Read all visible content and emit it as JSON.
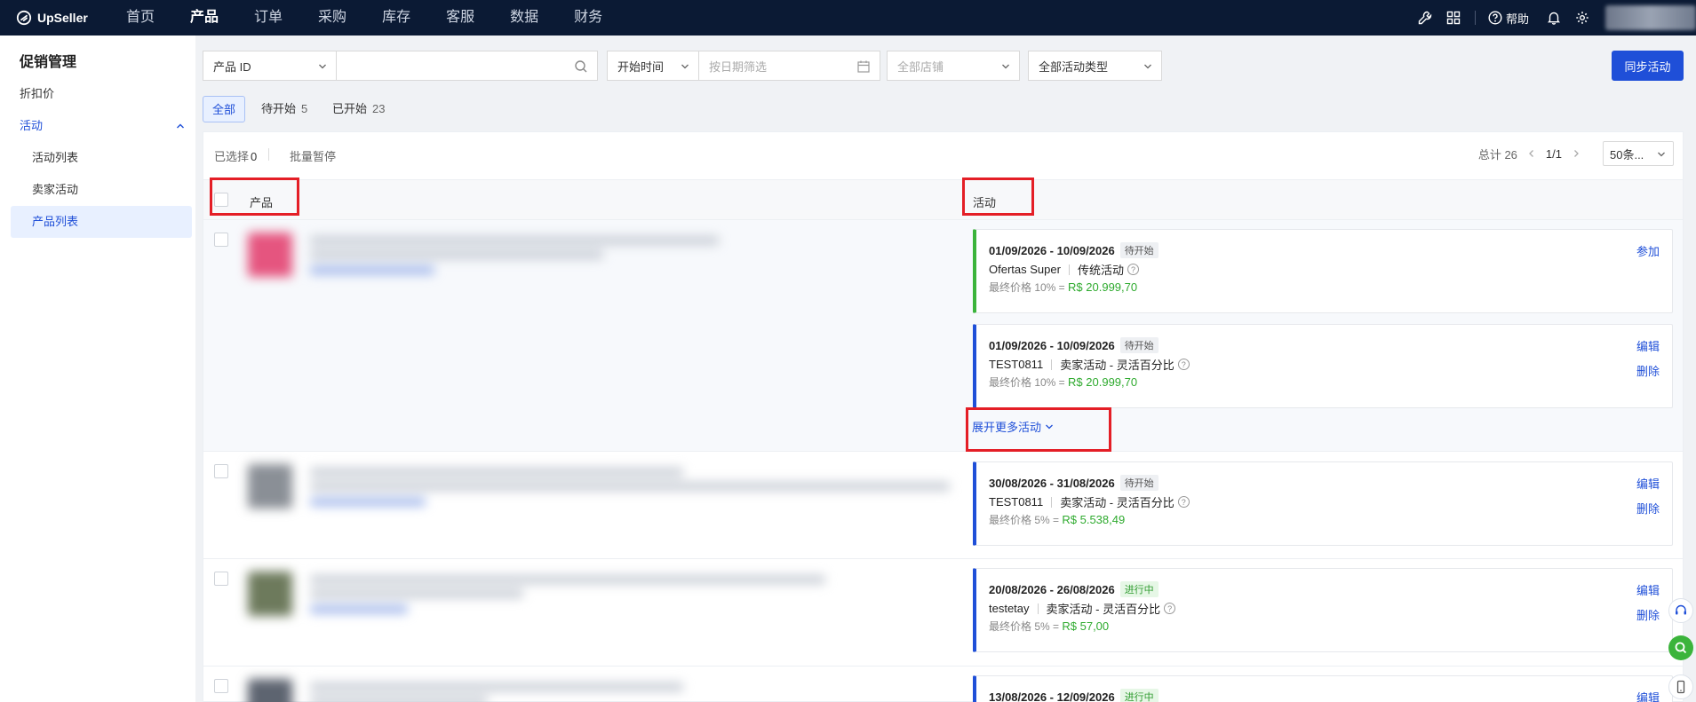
{
  "brand": {
    "name": "UpSeller"
  },
  "nav": {
    "items": [
      "首页",
      "产品",
      "订单",
      "采购",
      "库存",
      "客服",
      "数据",
      "财务"
    ],
    "active_index": 1,
    "help_label": "帮助"
  },
  "sidebar": {
    "title": "促销管理",
    "items": [
      {
        "label": "折扣价"
      },
      {
        "label": "活动"
      },
      {
        "label": "活动列表"
      },
      {
        "label": "卖家活动"
      },
      {
        "label": "产品列表"
      }
    ]
  },
  "filters": {
    "id_select": "产品 ID",
    "search_value": "",
    "time_select": "开始时间",
    "date_placeholder": "按日期筛选",
    "store_placeholder": "全部店铺",
    "type_select": "全部活动类型",
    "sync_button": "同步活动"
  },
  "tabs": [
    {
      "label": "全部",
      "count": ""
    },
    {
      "label": "待开始",
      "count": "5"
    },
    {
      "label": "已开始",
      "count": "23"
    }
  ],
  "toolbar": {
    "selected_label": "已选择",
    "selected_count": "0",
    "batch_pause": "批量暂停",
    "total_label": "总计 26",
    "page": "1/1",
    "page_size": "50条..."
  },
  "table": {
    "col_product": "产品",
    "col_activity": "活动",
    "expand_more": "展开更多活动",
    "activities": [
      {
        "date": "01/09/2026 - 10/09/2026",
        "status": "待开始",
        "name": "Ofertas Super",
        "type": "传统活动",
        "price_label": "最终价格 10% =",
        "price": "R$ 20.999,70",
        "actions": [
          "参加"
        ]
      },
      {
        "date": "01/09/2026 - 10/09/2026",
        "status": "待开始",
        "name": "TEST0811",
        "type": "卖家活动 - 灵活百分比",
        "price_label": "最终价格 10% =",
        "price": "R$ 20.999,70",
        "actions": [
          "编辑",
          "删除"
        ]
      },
      {
        "date": "30/08/2026 - 31/08/2026",
        "status": "待开始",
        "name": "TEST0811",
        "type": "卖家活动 - 灵活百分比",
        "price_label": "最终价格 5% =",
        "price": "R$ 5.538,49",
        "actions": [
          "编辑",
          "删除"
        ]
      },
      {
        "date": "20/08/2026 - 26/08/2026",
        "status": "进行中",
        "name": "testetay",
        "type": "卖家活动 - 灵活百分比",
        "price_label": "最终价格 5% =",
        "price": "R$ 57,00",
        "actions": [
          "编辑",
          "删除"
        ]
      },
      {
        "date": "13/08/2026 - 12/09/2026",
        "status": "进行中",
        "actions": [
          "编辑"
        ]
      }
    ]
  },
  "colors": {
    "primary": "#1f4fd8",
    "nav_bg": "#0b1a34",
    "highlight": "#e41e26",
    "live": "#3bb43b"
  }
}
